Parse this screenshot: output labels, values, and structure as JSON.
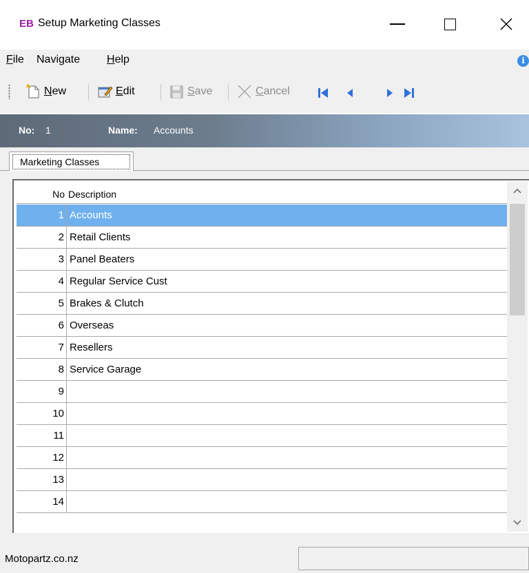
{
  "window": {
    "badge": "EB",
    "title": "Setup Marketing Classes"
  },
  "menu": {
    "file_key": "F",
    "file_rest": "ile",
    "navigate": "Navigate",
    "help_key": "H",
    "help_rest": "elp"
  },
  "toolbar": {
    "new_key": "N",
    "new_rest": "ew",
    "edit_key": "E",
    "edit_rest": "dit",
    "save_key": "S",
    "save_rest": "ave",
    "cancel_key": "C",
    "cancel_rest": "ancel"
  },
  "record": {
    "no_label": "No:",
    "no_value": "1",
    "name_label": "Name:",
    "name_value": "Accounts"
  },
  "tab": {
    "label": "Marketing Classes"
  },
  "grid": {
    "columns": {
      "no": "No",
      "description": "Description"
    },
    "rows": [
      {
        "no": "1",
        "description": "Accounts"
      },
      {
        "no": "2",
        "description": "Retail Clients"
      },
      {
        "no": "3",
        "description": "Panel Beaters"
      },
      {
        "no": "4",
        "description": "Regular Service Cust"
      },
      {
        "no": "5",
        "description": "Brakes & Clutch"
      },
      {
        "no": "6",
        "description": "Overseas"
      },
      {
        "no": "7",
        "description": "Resellers"
      },
      {
        "no": "8",
        "description": "Service Garage"
      },
      {
        "no": "9",
        "description": ""
      },
      {
        "no": "10",
        "description": ""
      },
      {
        "no": "11",
        "description": ""
      },
      {
        "no": "12",
        "description": ""
      },
      {
        "no": "13",
        "description": ""
      },
      {
        "no": "14",
        "description": ""
      }
    ],
    "selected_row": 0
  },
  "status": {
    "left": "Motopartz.co.nz",
    "right": ""
  },
  "colors": {
    "badge": "#9b1fa0",
    "selection": "#6fb0ee",
    "nav_arrow": "#3070d8"
  }
}
